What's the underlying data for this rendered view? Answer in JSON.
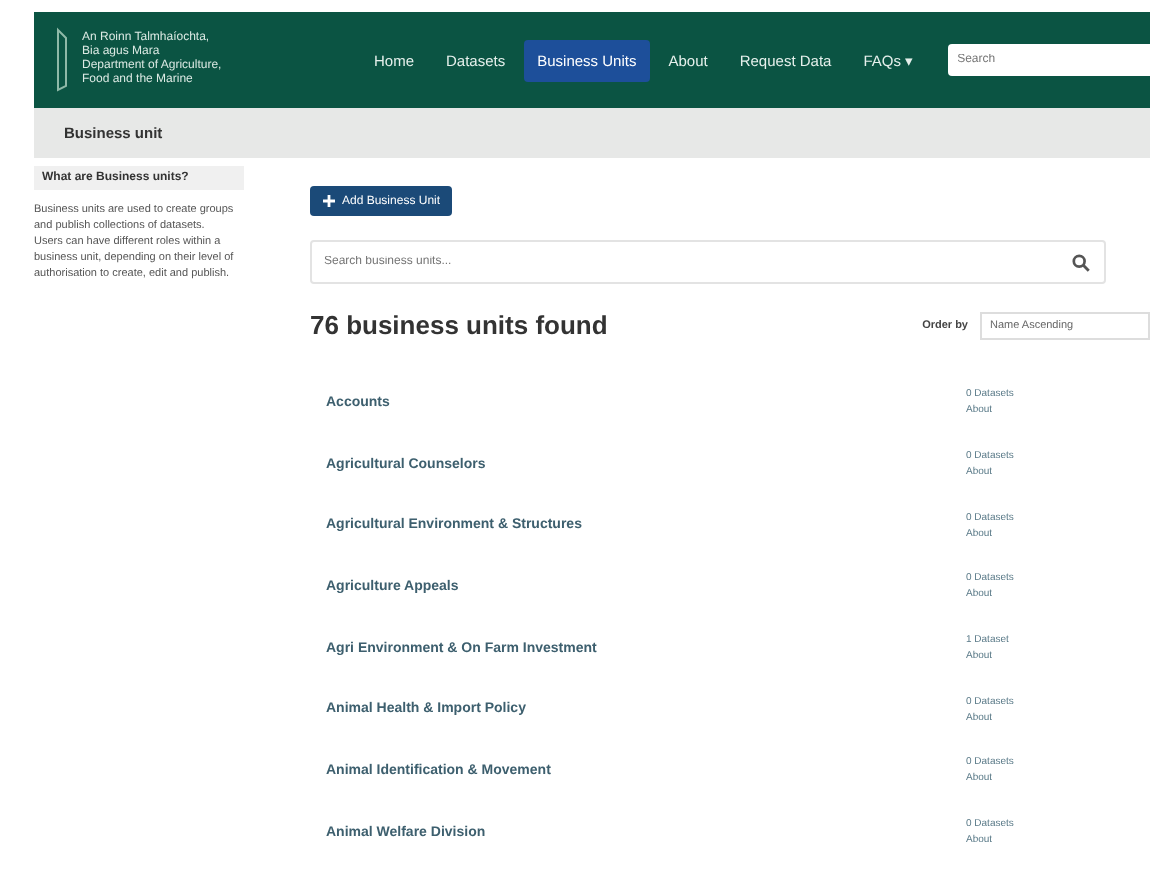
{
  "header": {
    "org_lines": [
      "An Roinn Talmhaíochta,",
      "Bia agus Mara",
      "Department of Agriculture,",
      "Food and the Marine"
    ],
    "nav": [
      {
        "label": "Home",
        "selected": false
      },
      {
        "label": "Datasets",
        "selected": false
      },
      {
        "label": "Business Units",
        "selected": true
      },
      {
        "label": "About",
        "selected": false
      },
      {
        "label": "Request Data",
        "selected": false
      },
      {
        "label": "FAQs ▾",
        "selected": false
      }
    ],
    "search": {
      "placeholder": "Search"
    }
  },
  "breadcrumb": "Business unit",
  "sidebar": {
    "title": "What are Business units?",
    "text": "Business units are used to create groups and publish collections of datasets. Users can have different roles within a business unit, depending on their level of authorisation to create, edit and publish."
  },
  "add_button": "Add Business Unit",
  "unit_search": {
    "placeholder": "Search business units..."
  },
  "result_count": "76 business units found",
  "order_by": {
    "label": "Order by",
    "value": "Name Ascending"
  },
  "units": [
    {
      "name": "Accounts",
      "datasets": "0 Datasets",
      "about": "About"
    },
    {
      "name": "Agricultural Counselors",
      "datasets": "0 Datasets",
      "about": "About"
    },
    {
      "name": "Agricultural Environment & Structures",
      "datasets": "0 Datasets",
      "about": "About"
    },
    {
      "name": "Agriculture Appeals",
      "datasets": "0 Datasets",
      "about": "About"
    },
    {
      "name": "Agri Environment & On Farm Investment",
      "datasets": "1 Dataset",
      "about": "About"
    },
    {
      "name": "Animal Health & Import Policy",
      "datasets": "0 Datasets",
      "about": "About"
    },
    {
      "name": "Animal Identification & Movement",
      "datasets": "0 Datasets",
      "about": "About"
    },
    {
      "name": "Animal Welfare Division",
      "datasets": "0 Datasets",
      "about": "About"
    }
  ]
}
